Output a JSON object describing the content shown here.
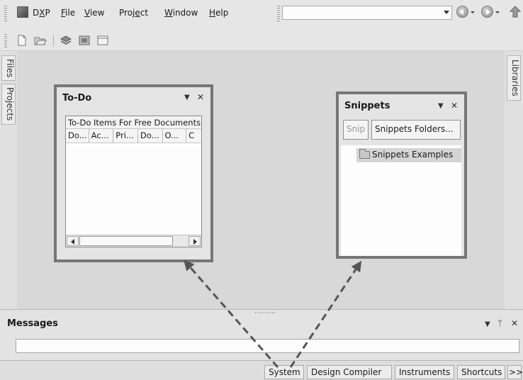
{
  "menubar": {
    "items": [
      {
        "label": "DXP",
        "key": "X"
      },
      {
        "label": "File",
        "key": "F"
      },
      {
        "label": "View",
        "key": "V"
      },
      {
        "label": "Project",
        "key": "e"
      },
      {
        "label": "Window",
        "key": "W"
      },
      {
        "label": "Help",
        "key": "H"
      }
    ],
    "search_value": ""
  },
  "toolbar": {
    "icons": [
      "new-document-icon",
      "open-folder-icon",
      "layers-icon",
      "device-sheet-icon",
      "window-icon"
    ]
  },
  "left_dock": {
    "tabs": [
      {
        "label": "Files"
      },
      {
        "label": "Projects"
      }
    ]
  },
  "right_dock": {
    "tabs": [
      {
        "label": "Libraries"
      }
    ]
  },
  "todo_panel": {
    "title": "To-Do",
    "dropdown_glyph": "▼",
    "close_glyph": "✕",
    "list_header": "To-Do Items For Free Documents",
    "columns": [
      "Do...",
      "Ac...",
      "Pri...",
      "Do...",
      "O...",
      "C"
    ]
  },
  "snippets_panel": {
    "title": "Snippets",
    "dropdown_glyph": "▼",
    "close_glyph": "✕",
    "snip_button": "Snip",
    "folders_button": "Snippets Folders...",
    "items": [
      {
        "label": "Snippets Examples"
      }
    ]
  },
  "messages_panel": {
    "title": "Messages",
    "dropdown_glyph": "▼",
    "pin_glyph": "ᛘ",
    "close_glyph": "✕",
    "input_value": ""
  },
  "statusbar": {
    "buttons": [
      {
        "label": "System"
      },
      {
        "label": "Design Compiler"
      },
      {
        "label": "Instruments"
      },
      {
        "label": "Shortcuts"
      },
      {
        "label": ">>"
      }
    ]
  },
  "colors": {
    "panel_border": "#767676",
    "arrow": "#555555",
    "background": "#d9d9d9"
  }
}
